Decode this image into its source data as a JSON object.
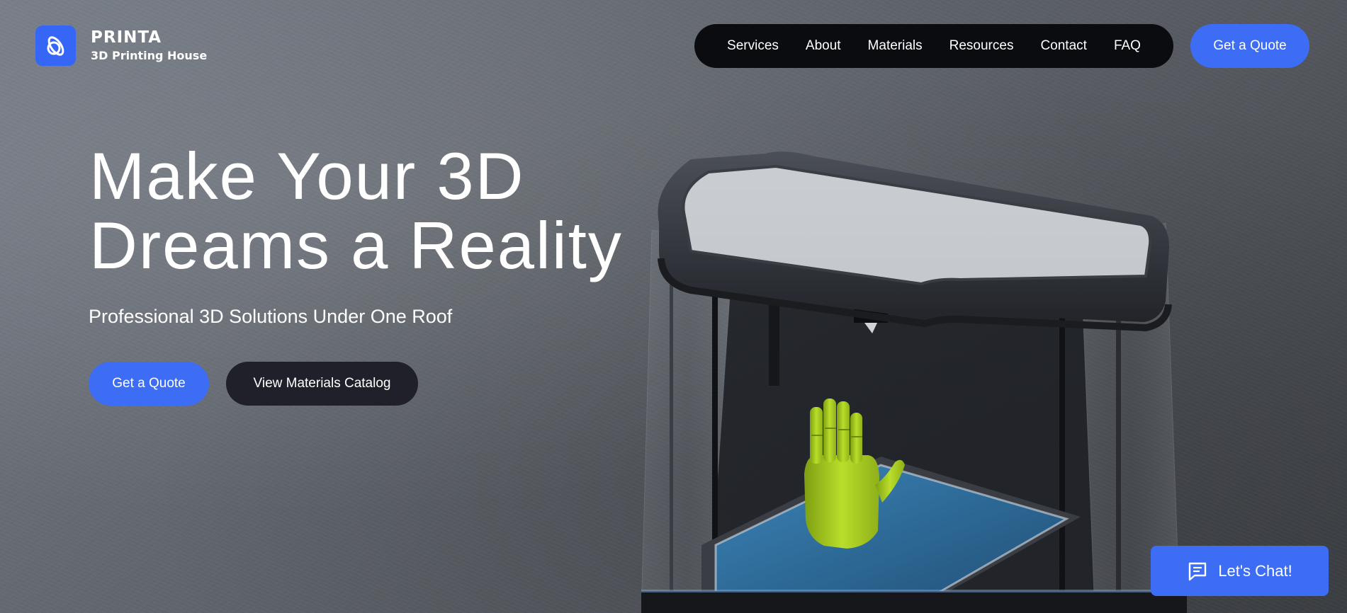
{
  "brand": {
    "name": "PRINTA",
    "tagline": "3D Printing House",
    "color": "#3566f5",
    "icon": "logo-icon"
  },
  "nav": {
    "items": [
      {
        "label": "Services"
      },
      {
        "label": "About"
      },
      {
        "label": "Materials"
      },
      {
        "label": "Resources"
      },
      {
        "label": "Contact"
      },
      {
        "label": "FAQ"
      }
    ],
    "cta_label": "Get a Quote"
  },
  "hero": {
    "title_line1": "Make Your 3D",
    "title_line2": "Dreams a Reality",
    "subtitle": "Professional 3D Solutions Under One Roof",
    "primary_cta": "Get a Quote",
    "secondary_cta": "View Materials Catalog"
  },
  "chat": {
    "label": "Let's Chat!",
    "icon": "chat-icon"
  },
  "colors": {
    "accent": "#3e6df5",
    "nav_bg": "#0b0c0f",
    "secondary_button": "#1f2029",
    "printed_hand": "#a8cc22",
    "build_plate": "#2e6f9e"
  }
}
